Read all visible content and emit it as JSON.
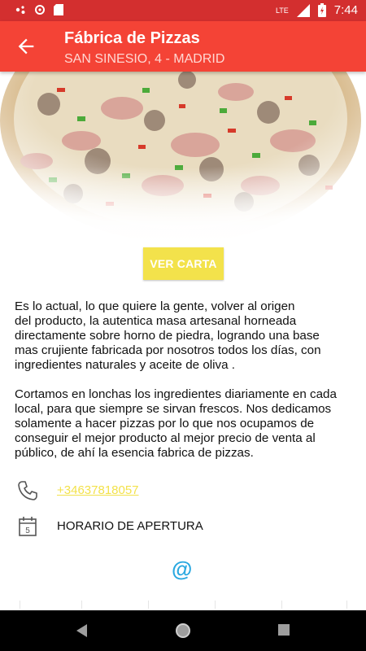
{
  "status_bar": {
    "time": "7:44",
    "network": "LTE",
    "icons": [
      "assistant-icon",
      "settings-icon",
      "sd-card-icon",
      "signal-icon",
      "battery-icon"
    ]
  },
  "app_bar": {
    "title": "Fábrica de Pizzas",
    "subtitle": "SAN SINESIO, 4 - MADRID",
    "back_icon": "arrow-back-icon"
  },
  "hero": {
    "image": "pizza-photo"
  },
  "menu_button": {
    "label": "VER CARTA"
  },
  "description": {
    "paragraphs": [
      "Es lo actual, lo que quiere la gente, volver al origen\ndel producto, la autentica masa artesanal horneada\ndirectamente sobre horno de piedra, logrando una base\nmas crujiente fabricada por nosotros todos los días, con\ningredientes naturales y aceite de oliva .",
      "Cortamos en lonchas los ingredientes diariamente en cada\nlocal, para que siempre se sirvan frescos. Nos dedicamos\nsolamente  a hacer pizzas por lo que nos ocupamos de\nconseguir el mejor producto al mejor precio de venta al\npúblico, de ahí la esencia fabrica de pizzas."
    ]
  },
  "contact": {
    "phone": "+34637818057",
    "phone_icon": "phone-icon",
    "hours_label": "HORARIO DE APERTURA",
    "hours_icon": "calendar-icon",
    "calendar_day": "5",
    "email_symbol": "@"
  },
  "colors": {
    "status_bar": "#d32f2f",
    "app_bar": "#f44336",
    "accent_yellow": "#f3e24b",
    "email_blue": "#29a8e0"
  },
  "nav_bar": {
    "icons": [
      "back-triangle-icon",
      "home-circle-icon",
      "recents-square-icon"
    ]
  }
}
